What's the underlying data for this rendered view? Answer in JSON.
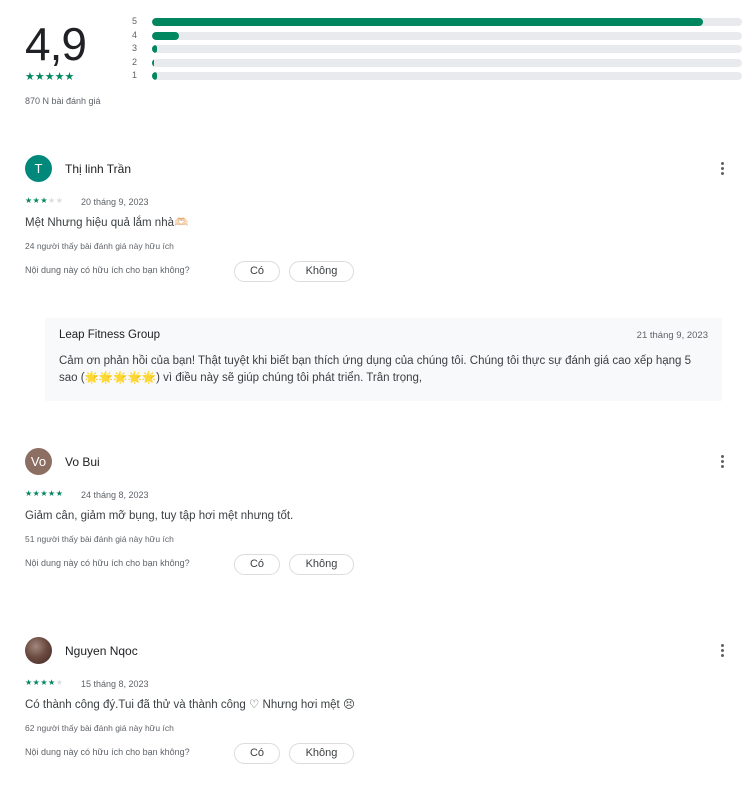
{
  "summary": {
    "score": "4,9",
    "stars": "★★★★★",
    "review_count": "870 N bài đánh giá",
    "histogram": [
      {
        "label": "5",
        "fraction": 0.934
      },
      {
        "label": "4",
        "fraction": 0.046
      },
      {
        "label": "3",
        "fraction": 0.008
      },
      {
        "label": "2",
        "fraction": 0.002
      },
      {
        "label": "1",
        "fraction": 0.008
      }
    ],
    "accent_color": "#01875f"
  },
  "helpful_question": "Nội dung này có hữu ích cho bạn không?",
  "yes_label": "Có",
  "no_label": "Không",
  "reviews": [
    {
      "author": "Thị linh Trần",
      "avatar_letter": "T",
      "avatar_color": "#00897b",
      "rating": 3,
      "date": "20 tháng 9, 2023",
      "text": "Mệt Nhưng hiệu quả lắm nhà🫶🏻",
      "helpful_count": "24 người thấy bài đánh giá này hữu ích"
    },
    {
      "author": "Vo Bui",
      "avatar_letter": "Vo",
      "avatar_color": "#8d6e63",
      "rating": 5,
      "date": "24 tháng 8, 2023",
      "text": "Giảm cân, giảm mỡ bụng, tuy tập hơi mệt nhưng tốt.",
      "helpful_count": "51 người thấy bài đánh giá này hữu ích"
    },
    {
      "author": "Nguyen Nqoc",
      "avatar_letter": "",
      "avatar_color": "#6d4c41",
      "rating": 4,
      "date": "15 tháng 8, 2023",
      "text": "Có thành công đý.Tui đã thử và thành công ♡ Nhưng hơi mệt 😣",
      "helpful_count": "62 người thấy bài đánh giá này hữu ích"
    }
  ],
  "reply": {
    "author": "Leap Fitness Group",
    "date": "21 tháng 9, 2023",
    "text": "Cảm ơn phản hồi của bạn! Thật tuyệt khi biết bạn thích ứng dụng của chúng tôi. Chúng tôi thực sự đánh giá cao xếp hạng 5 sao (🌟🌟🌟🌟🌟) vì điều này sẽ giúp chúng tôi phát triển. Trân trọng,"
  },
  "icons": {
    "more": "more-vert-icon",
    "star": "star-icon"
  }
}
